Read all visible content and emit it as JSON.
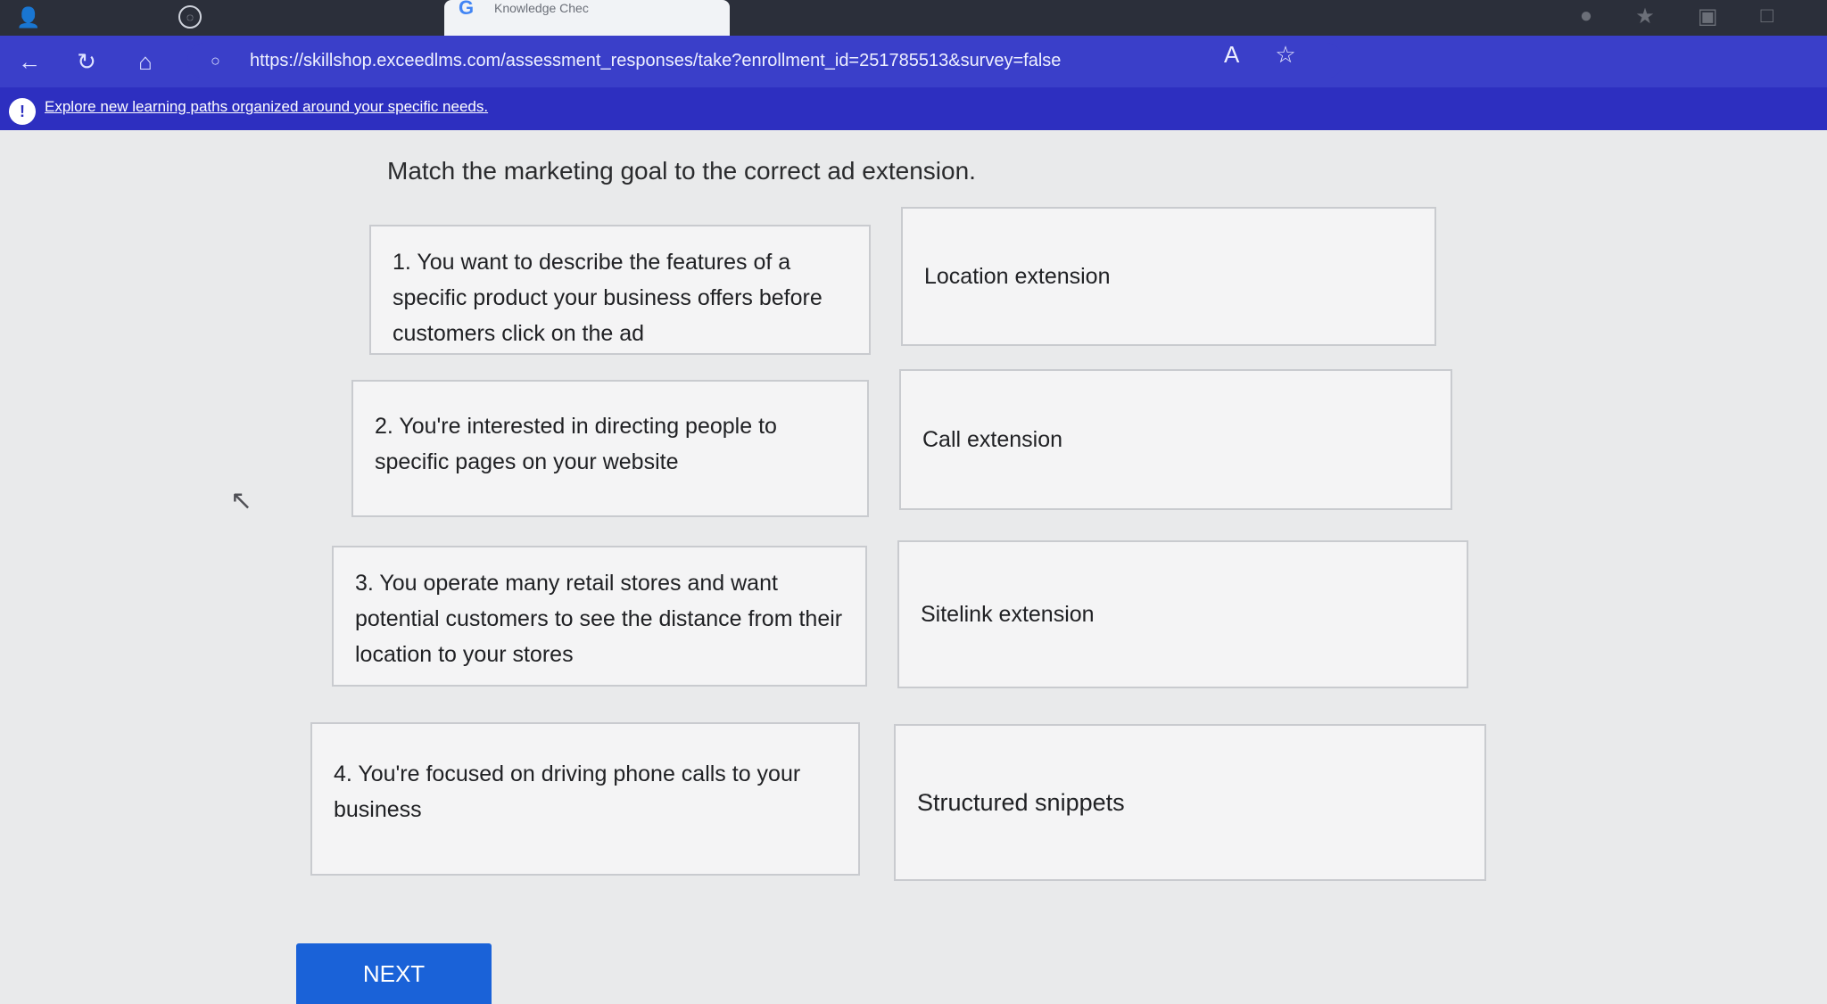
{
  "browser": {
    "active_tab_title": "Knowledge Chec",
    "url": "https://skillshop.exceedlms.com/assessment_responses/take?enrollment_id=251785513&survey=false"
  },
  "banner": {
    "link_text": "Explore new learning paths organized around your specific needs."
  },
  "assessment": {
    "question": "Match the marketing goal to the correct ad extension.",
    "goals": [
      "1. You want to describe the features of a specific product your business offers before customers click on the ad",
      "2. You're interested in directing people to specific pages on your website",
      "3. You operate many retail stores and want potential customers to see the distance from their location to your stores",
      "4. You're focused on driving phone calls to your business"
    ],
    "extensions": [
      "Location extension",
      "Call extension",
      "Sitelink extension",
      "Structured snippets"
    ],
    "next_label": "NEXT"
  },
  "icons": {
    "profile": "profile-icon",
    "back": "back-arrow-icon",
    "refresh": "refresh-icon",
    "home": "home-icon",
    "lock": "lock-icon",
    "read_aloud": "read-aloud-icon",
    "favorite": "star-icon",
    "info": "info-icon",
    "cursor": "mouse-pointer-icon"
  },
  "colors": {
    "address_bar": "#3a3fc9",
    "banner": "#2d2fc0",
    "next_button": "#1a62d8"
  }
}
